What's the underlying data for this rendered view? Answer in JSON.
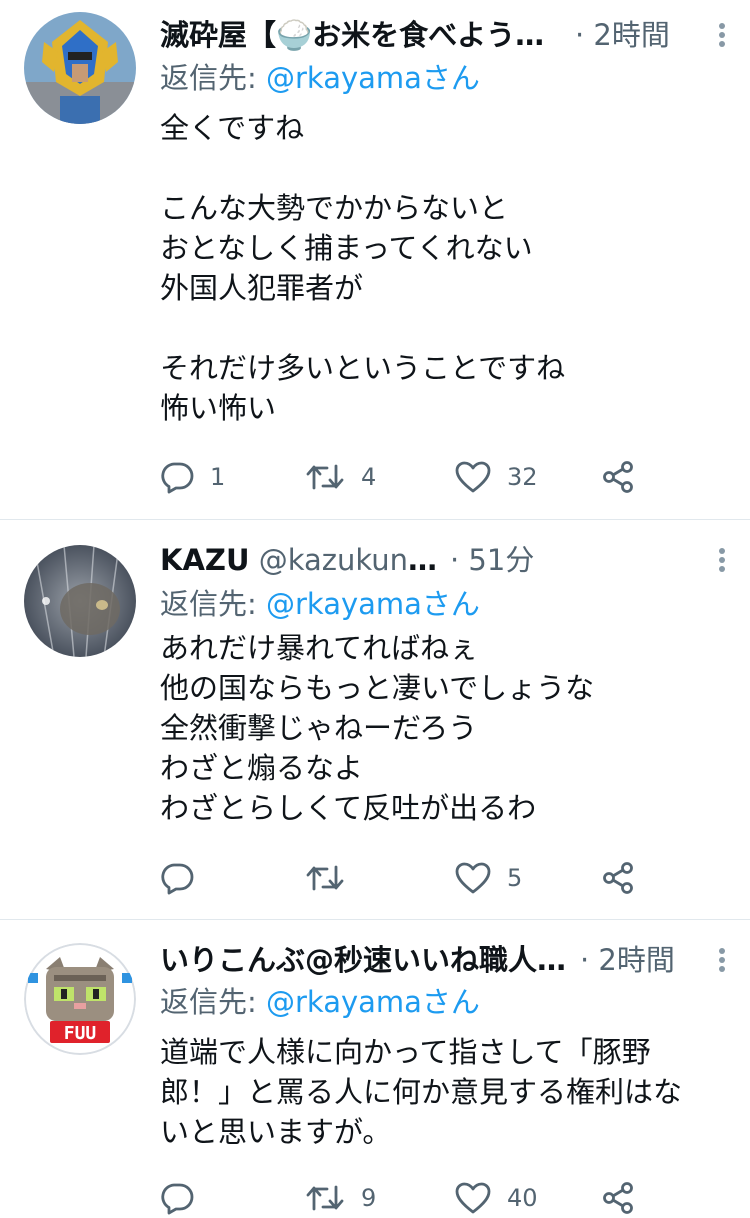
{
  "tweets": [
    {
      "name": "滅砕屋【🍚お米を食べよう…",
      "handle": "",
      "time": "· 2時間",
      "reply_prefix": "返信先: ",
      "reply_mention": "@rkayamaさん",
      "text": "全くですね\n\nこんな大勢でかからないと\nおとなしく捕まってくれない\n外国人犯罪者が\n\nそれだけ多いということですね\n怖い怖い",
      "replies": "1",
      "retweets": "4",
      "likes": "32"
    },
    {
      "name": "KAZU",
      "handle": " @kazukunelt",
      "time": "· 51分",
      "reply_prefix": "返信先: ",
      "reply_mention": "@rkayamaさん",
      "text": "あれだけ暴れてればねぇ\n他の国ならもっと凄いでしょうな\n全然衝撃じゃねーだろう\nわざと煽るなよ\nわざとらしくて反吐が出るわ",
      "replies": "",
      "retweets": "",
      "likes": "5"
    },
    {
      "name": "いりこんぶ@秒速いいね職人 …",
      "handle": "",
      "time": "· 2時間",
      "reply_prefix": "返信先: ",
      "reply_mention": "@rkayamaさん",
      "text": "道端で人様に向かって指さして「豚野\n郎！」と罵る人に何か意見する権利はな\nいと思いますが。",
      "replies": "",
      "retweets": "9",
      "likes": "40",
      "avatar_badge": "FUU"
    }
  ],
  "colors": {
    "text": "#0f1419",
    "secondary": "#536471",
    "link": "#1d9bf0",
    "divider": "#e1e8ed"
  },
  "icons": [
    "reply-icon",
    "retweet-icon",
    "like-icon",
    "share-icon",
    "more-icon"
  ]
}
